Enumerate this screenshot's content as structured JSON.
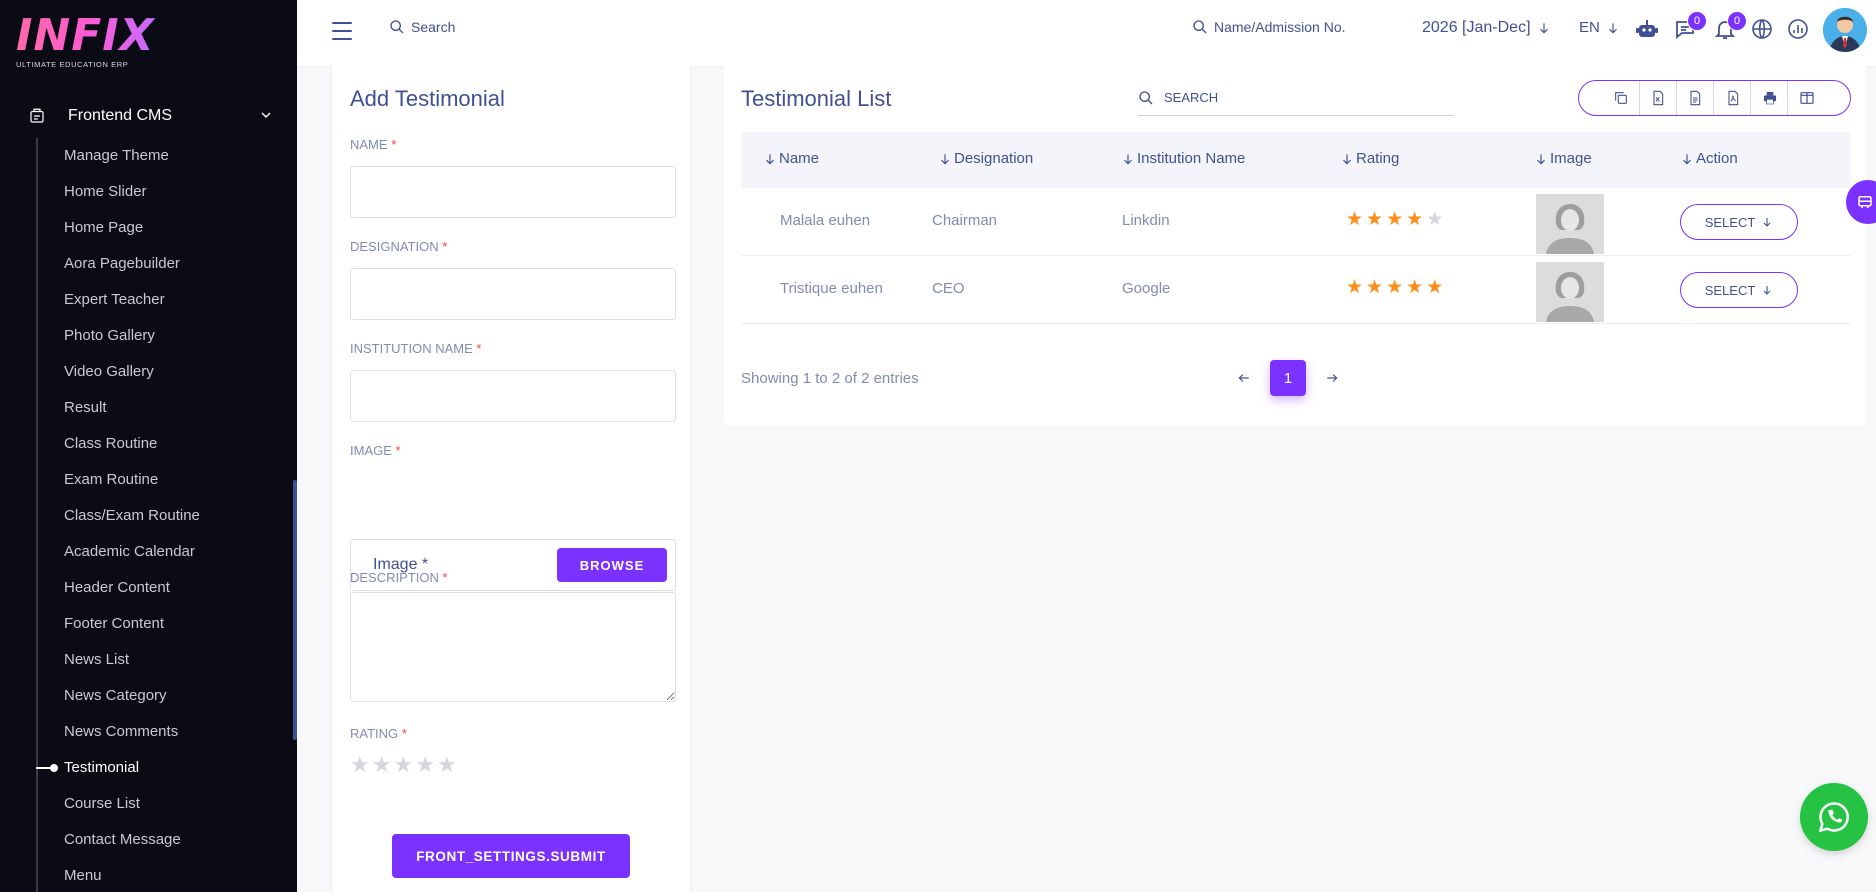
{
  "brand": {
    "logo": "INFIX",
    "tagline": "ULTIMATE EDUCATION ERP"
  },
  "sidebar": {
    "section": {
      "label": "Frontend CMS",
      "icon": "gear-icon"
    },
    "items": [
      {
        "label": "Manage Theme"
      },
      {
        "label": "Home Slider"
      },
      {
        "label": "Home Page"
      },
      {
        "label": "Aora Pagebuilder"
      },
      {
        "label": "Expert Teacher"
      },
      {
        "label": "Photo Gallery"
      },
      {
        "label": "Video Gallery"
      },
      {
        "label": "Result"
      },
      {
        "label": "Class Routine"
      },
      {
        "label": "Exam Routine"
      },
      {
        "label": "Class/Exam Routine"
      },
      {
        "label": "Academic Calendar"
      },
      {
        "label": "Header Content"
      },
      {
        "label": "Footer Content"
      },
      {
        "label": "News List"
      },
      {
        "label": "News Category"
      },
      {
        "label": "News Comments"
      },
      {
        "label": "Testimonial",
        "active": true
      },
      {
        "label": "Course List"
      },
      {
        "label": "Contact Message"
      },
      {
        "label": "Menu"
      }
    ]
  },
  "topbar": {
    "search_placeholder": "Search",
    "admission_placeholder": "Name/Admission No.",
    "year": "2026 [Jan-Dec]",
    "lang": "EN",
    "chat_badge": "0",
    "notification_badge": "0"
  },
  "add_form": {
    "title": "Add Testimonial",
    "name_label": "NAME",
    "designation_label": "DESIGNATION",
    "institution_label": "INSTITUTION NAME",
    "image_label": "IMAGE",
    "image_placeholder": "Image *",
    "browse_label": "BROWSE",
    "description_label": "DESCRIPTION",
    "rating_label": "RATING",
    "required_mark": "*",
    "submit_label": "FRONT_SETTINGS.SUBMIT"
  },
  "list": {
    "title": "Testimonial List",
    "search_placeholder": "SEARCH",
    "columns": [
      "Name",
      "Designation",
      "Institution Name",
      "Rating",
      "Image",
      "Action"
    ],
    "rows": [
      {
        "name": "Malala euhen",
        "designation": "Chairman",
        "institution": "Linkdin",
        "rating": 4,
        "action": "SELECT"
      },
      {
        "name": "Tristique euhen",
        "designation": "CEO",
        "institution": "Google",
        "rating": 5,
        "action": "SELECT"
      }
    ],
    "info": "Showing 1 to 2 of 2 entries",
    "page": "1"
  },
  "colors": {
    "accent": "#7c32ff",
    "text": "#415094",
    "muted": "#828bb2",
    "star": "#fd8e1a",
    "whatsapp": "#25c244"
  }
}
